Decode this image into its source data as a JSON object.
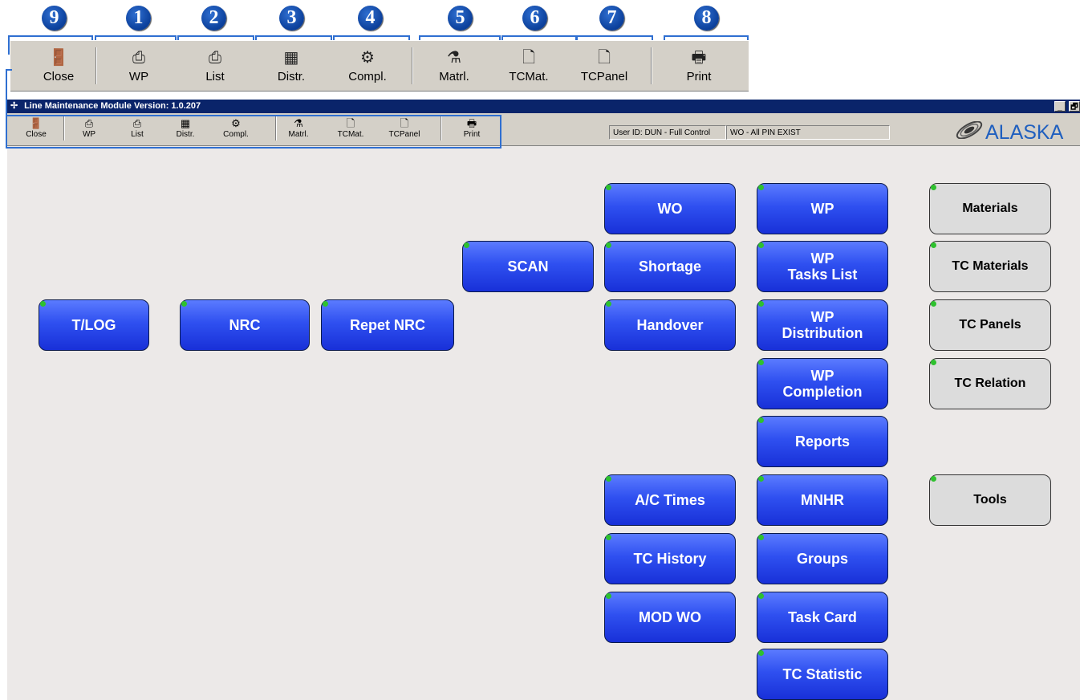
{
  "callout": {
    "badges": [
      "9",
      "1",
      "2",
      "3",
      "4",
      "5",
      "6",
      "7",
      "8"
    ],
    "buttons": [
      {
        "label": "Close",
        "icon": "door-exit-icon",
        "glyph": "🚪"
      },
      {
        "label": "WP",
        "icon": "printer-icon",
        "glyph": "⎙"
      },
      {
        "label": "List",
        "icon": "printer-icon",
        "glyph": "⎙"
      },
      {
        "label": "Distr.",
        "icon": "distribution-icon",
        "glyph": "▦"
      },
      {
        "label": "Compl.",
        "icon": "wrench-icon",
        "glyph": "⚙"
      },
      {
        "label": "Matrl.",
        "icon": "flask-icon",
        "glyph": "⚗"
      },
      {
        "label": "TCMat.",
        "icon": "document-icon",
        "glyph": "🗋"
      },
      {
        "label": "TCPanel",
        "icon": "document-icon",
        "glyph": "🗋"
      },
      {
        "label": "Print",
        "icon": "printer-icon",
        "glyph": "🖶"
      }
    ]
  },
  "window": {
    "title": "Line Maintenance Module  Version: 1.0.207",
    "controls": [
      "_",
      "🗗"
    ]
  },
  "toolbar": {
    "buttons": [
      {
        "label": "Close",
        "glyph": "🚪"
      },
      {
        "label": "WP",
        "glyph": "⎙"
      },
      {
        "label": "List",
        "glyph": "⎙"
      },
      {
        "label": "Distr.",
        "glyph": "▦"
      },
      {
        "label": "Compl.",
        "glyph": "⚙"
      },
      {
        "label": "Matrl.",
        "glyph": "⚗"
      },
      {
        "label": "TCMat.",
        "glyph": "🗋"
      },
      {
        "label": "TCPanel",
        "glyph": "🗋"
      },
      {
        "label": "Print",
        "glyph": "🖶"
      }
    ],
    "user_status": "User ID: DUN - Full Control",
    "wo_status": "WO - All  PIN EXIST",
    "logo_text": "ALASKA"
  },
  "tiles": {
    "tlog": "T/LOG",
    "nrc": "NRC",
    "repet_nrc": "Repet NRC",
    "scan": "SCAN",
    "wo": "WO",
    "shortage": "Shortage",
    "handover": "Handover",
    "ac_times": "A/C Times",
    "tc_history": "TC History",
    "mod_wo": "MOD WO",
    "wp": "WP",
    "wp_tasks_1": "WP",
    "wp_tasks_2": "Tasks List",
    "wp_dist_1": "WP",
    "wp_dist_2": "Distribution",
    "wp_compl_1": "WP",
    "wp_compl_2": "Completion",
    "reports": "Reports",
    "mnhr": "MNHR",
    "groups": "Groups",
    "task_card": "Task Card",
    "tc_statistic": "TC Statistic",
    "materials": "Materials",
    "tc_materials": "TC Materials",
    "tc_panels": "TC Panels",
    "tc_relation": "TC Relation",
    "tools": "Tools"
  }
}
